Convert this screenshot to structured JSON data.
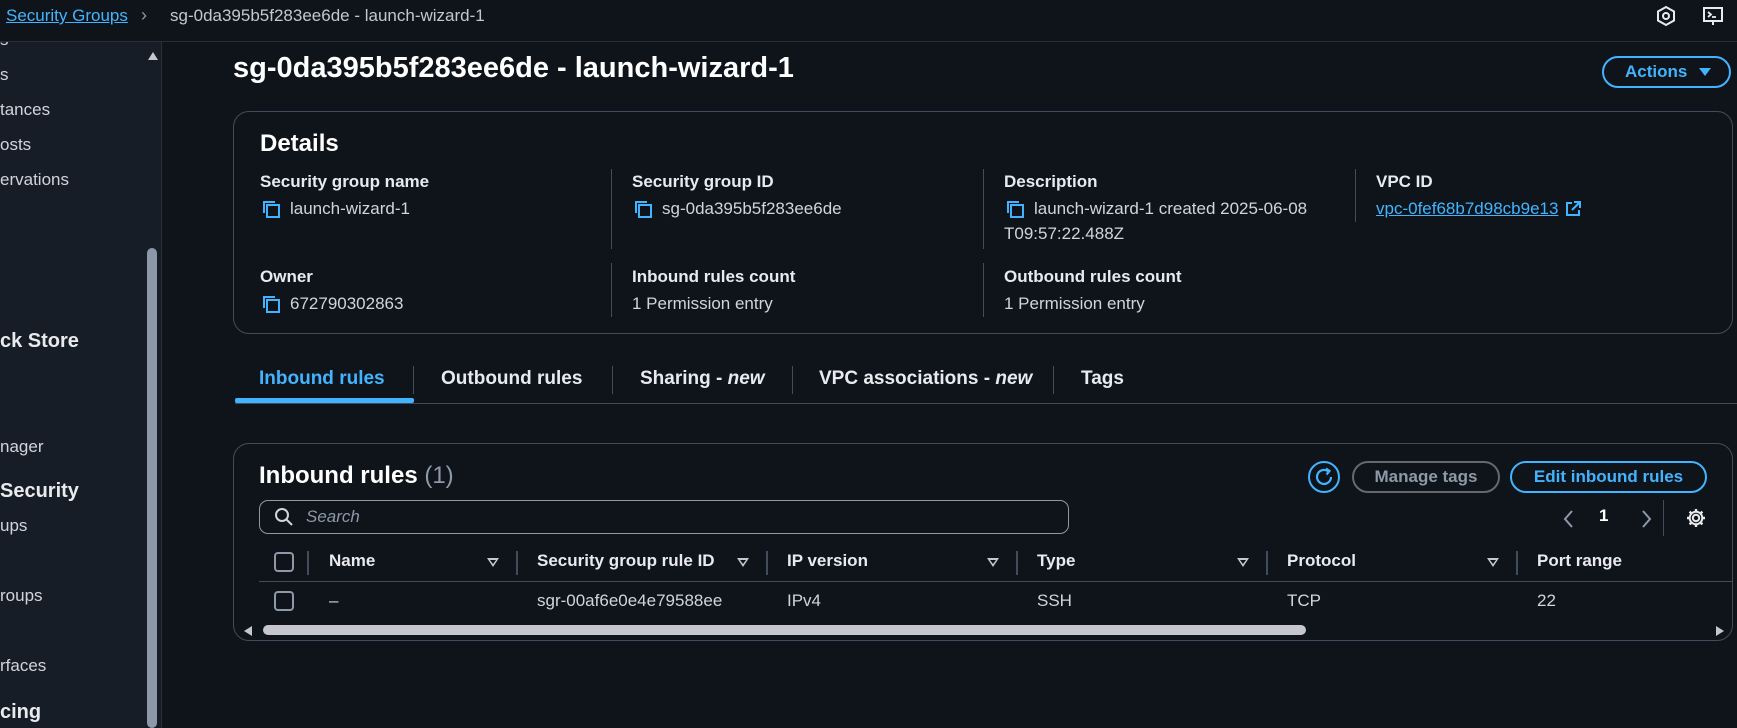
{
  "breadcrumb": {
    "parent": "Security Groups",
    "current": "sg-0da395b5f283ee6de - launch-wizard-1"
  },
  "sidebar": {
    "items": [
      "s",
      "s",
      "tances",
      "osts",
      "ervations",
      "ck Store",
      "nager",
      "Security",
      "ups",
      "roups",
      "rfaces",
      "cing"
    ]
  },
  "page": {
    "title": "sg-0da395b5f283ee6de - launch-wizard-1",
    "actions_label": "Actions"
  },
  "details": {
    "title": "Details",
    "security_group_name": {
      "label": "Security group name",
      "value": "launch-wizard-1"
    },
    "security_group_id": {
      "label": "Security group ID",
      "value": "sg-0da395b5f283ee6de"
    },
    "description": {
      "label": "Description",
      "value_line1": "launch-wizard-1 created 2025-06-08",
      "value_line2": "T09:57:22.488Z"
    },
    "vpc_id": {
      "label": "VPC ID",
      "value": "vpc-0fef68b7d98cb9e13"
    },
    "owner": {
      "label": "Owner",
      "value": "672790302863"
    },
    "inbound_count": {
      "label": "Inbound rules count",
      "value": "1 Permission entry"
    },
    "outbound_count": {
      "label": "Outbound rules count",
      "value": "1 Permission entry"
    }
  },
  "tabs": {
    "inbound": "Inbound rules",
    "outbound": "Outbound rules",
    "sharing": "Sharing - ",
    "sharing_new": "new",
    "vpc_assoc": "VPC associations - ",
    "vpc_assoc_new": "new",
    "tags": "Tags",
    "active": "inbound"
  },
  "inbound_panel": {
    "title": "Inbound rules",
    "count": "(1)",
    "manage_tags_label": "Manage tags",
    "edit_label": "Edit inbound rules",
    "search_placeholder": "Search",
    "page_number": "1",
    "columns": [
      "Name",
      "Security group rule ID",
      "IP version",
      "Type",
      "Protocol",
      "Port range"
    ],
    "rows": [
      [
        "–",
        "sgr-00af6e0e4e79588ee",
        "IPv4",
        "SSH",
        "TCP",
        "22"
      ]
    ]
  },
  "colors": {
    "accent": "#42b4ff",
    "background": "#0f141a",
    "sidebar": "#161d26",
    "border": "#414d5c"
  }
}
